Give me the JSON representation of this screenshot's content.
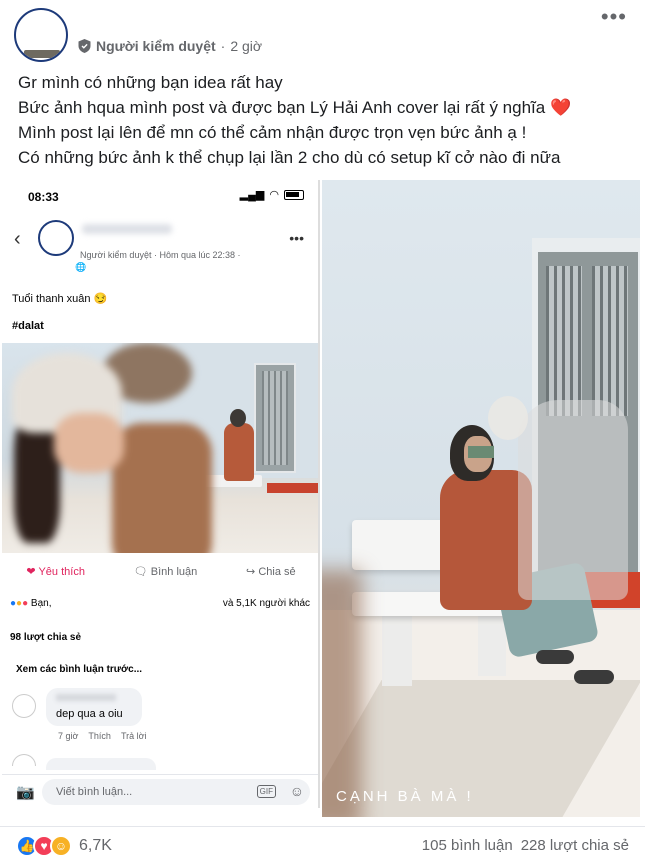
{
  "header": {
    "author_badge": "Người kiểm duyệt",
    "time": "2 giờ"
  },
  "post": {
    "lines": [
      "Gr mình có những bạn idea rất hay",
      "Bức ảnh hqua mình post và được bạn Lý Hải Anh cover lại rất ý nghĩa",
      "Mình post lại lên để mn có thể cảm nhận được trọn vẹn bức ảnh ạ !",
      "Có những bức ảnh k thể chụp lại lần 2 cho dù có setup kĩ cở nào đi nữa"
    ]
  },
  "screenshot": {
    "status_time": "08:33",
    "meta": "Người kiểm duyệt · Hôm qua lúc 22:38 ·",
    "caption": "Tuổi thanh xuân 😏",
    "hashtag": "#dalat",
    "like_label": "Yêu thích",
    "comment_label": "Bình luận",
    "share_label": "Chia sẻ",
    "reactions_left": "Bạn,",
    "reactions_right": "và 5,1K người khác",
    "share_count": "98 lượt chia sẻ",
    "prev_comments": "Xem các bình luận trước...",
    "comment_text": "dep qua a oiu",
    "comment_time": "7 giờ",
    "comment_like": "Thích",
    "comment_reply": "Trả lời",
    "write_placeholder": "Viết bình luận...",
    "gif_label": "GIF"
  },
  "photo": {
    "caption": "CẠNH BÀ MÀ !"
  },
  "footer": {
    "reaction_count": "6,7K",
    "comments": "105 bình luận",
    "shares": "228 lượt chia sẻ"
  },
  "colors": {
    "facebook_blue": "#1877f2",
    "love_red": "#f33e58",
    "secondary_text": "#65676b"
  }
}
